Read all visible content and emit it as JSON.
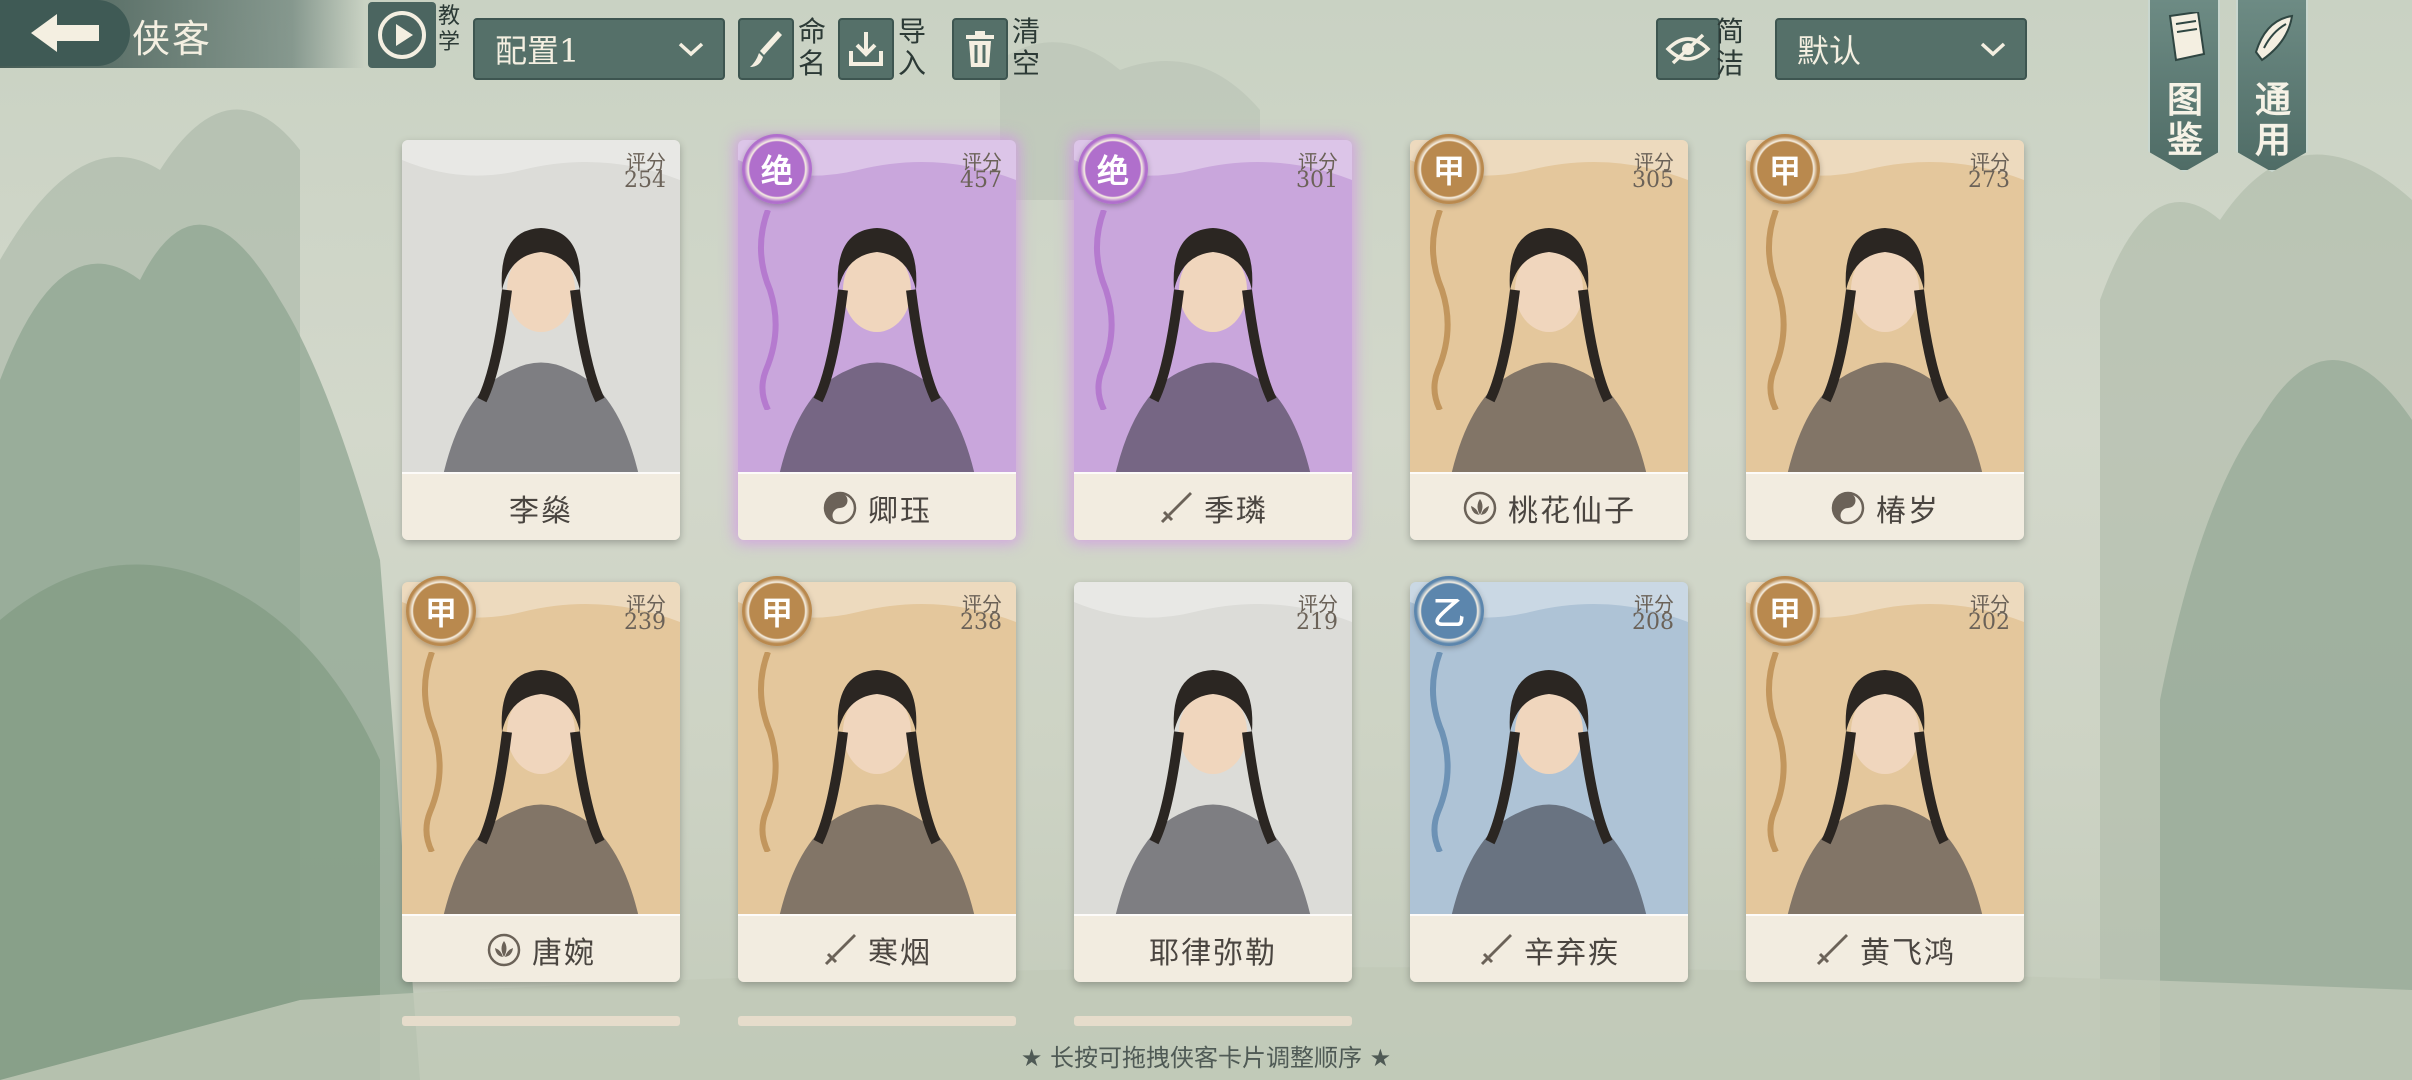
{
  "header": {
    "title": "侠客",
    "tutorial_label": "教学",
    "config_select": "配置1",
    "rename_label": "命名",
    "import_label": "导入",
    "clear_label": "清空",
    "simple_label": "简洁",
    "sort_select": "默认",
    "gallery_label": "图鉴",
    "common_label": "通用"
  },
  "score_label": "评分",
  "cards": [
    {
      "name": "李燊",
      "score": "254",
      "grade": "",
      "theme": "silver",
      "faction": ""
    },
    {
      "name": "卿珏",
      "score": "457",
      "grade": "绝",
      "theme": "violet",
      "faction": "taiji-icon"
    },
    {
      "name": "季璘",
      "score": "301",
      "grade": "绝",
      "theme": "violet",
      "faction": "sword-icon"
    },
    {
      "name": "桃花仙子",
      "score": "305",
      "grade": "甲",
      "theme": "gold",
      "faction": "lotus-icon"
    },
    {
      "name": "椿岁",
      "score": "273",
      "grade": "甲",
      "theme": "gold",
      "faction": "taiji-icon"
    },
    {
      "name": "唐婉",
      "score": "239",
      "grade": "甲",
      "theme": "gold",
      "faction": "lotus-icon"
    },
    {
      "name": "寒烟",
      "score": "238",
      "grade": "甲",
      "theme": "gold",
      "faction": "sword-icon"
    },
    {
      "name": "耶律弥勒",
      "score": "219",
      "grade": "",
      "theme": "silver",
      "faction": ""
    },
    {
      "name": "辛弃疾",
      "score": "208",
      "grade": "乙",
      "theme": "blue",
      "faction": "sword-icon"
    },
    {
      "name": "黄飞鸿",
      "score": "202",
      "grade": "甲",
      "theme": "gold",
      "faction": "sword-icon"
    }
  ],
  "hint": "★ 长按可拖拽侠客卡片调整顺序 ★",
  "colors": {
    "gold": "#e4c79c",
    "violet": "#c9a6dc",
    "blue": "#aec3d6",
    "silver": "#dcdcd8",
    "panel": "#557069"
  }
}
